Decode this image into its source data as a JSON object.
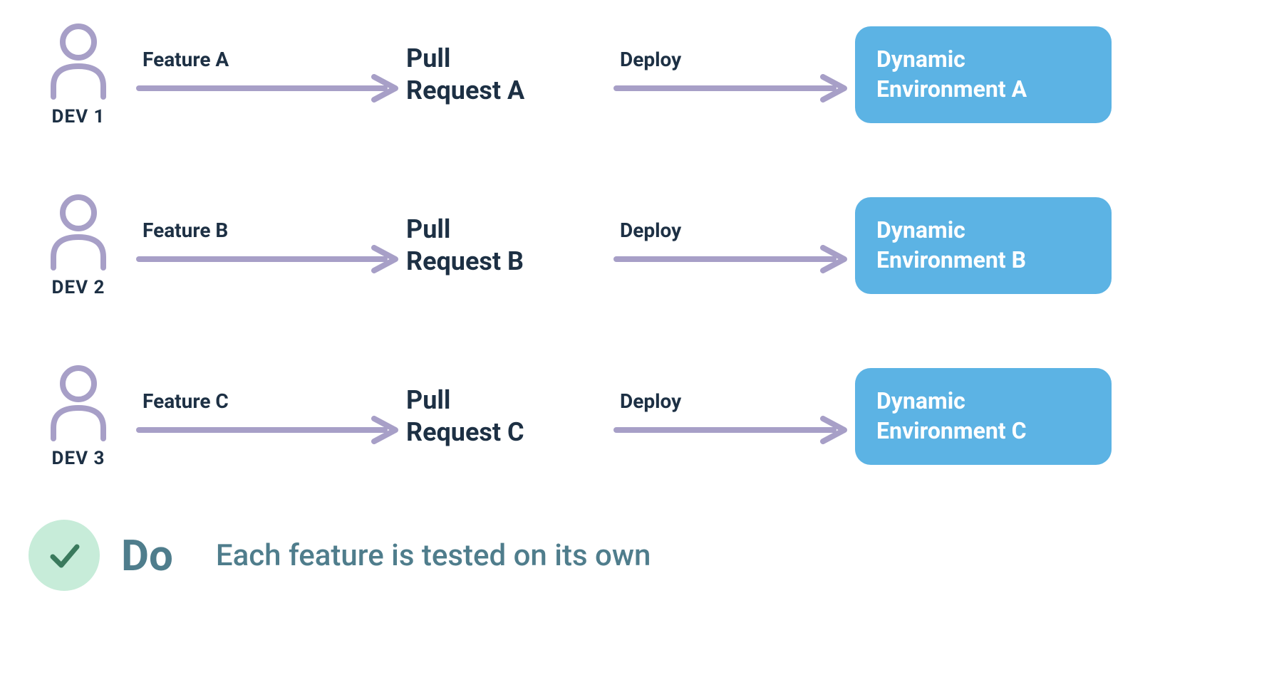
{
  "colors": {
    "dark": "#1d3044",
    "lavender": "#a79fc7",
    "blue": "#5cb3e4",
    "mint": "#c7ecd9",
    "teal": "#4f7d8c",
    "check": "#3a7a5d"
  },
  "rows": [
    {
      "dev_label": "DEV 1",
      "feature_label": "Feature A",
      "pr_line1": "Pull",
      "pr_line2": "Request A",
      "deploy_label": "Deploy",
      "env_line1": "Dynamic",
      "env_line2": "Environment A"
    },
    {
      "dev_label": "DEV 2",
      "feature_label": "Feature B",
      "pr_line1": "Pull",
      "pr_line2": "Request B",
      "deploy_label": "Deploy",
      "env_line1": "Dynamic",
      "env_line2": "Environment B"
    },
    {
      "dev_label": "DEV 3",
      "feature_label": "Feature C",
      "pr_line1": "Pull",
      "pr_line2": "Request C",
      "deploy_label": "Deploy",
      "env_line1": "Dynamic",
      "env_line2": "Environment C"
    }
  ],
  "footer": {
    "do_label": "Do",
    "caption": "Each feature is tested on its own"
  }
}
